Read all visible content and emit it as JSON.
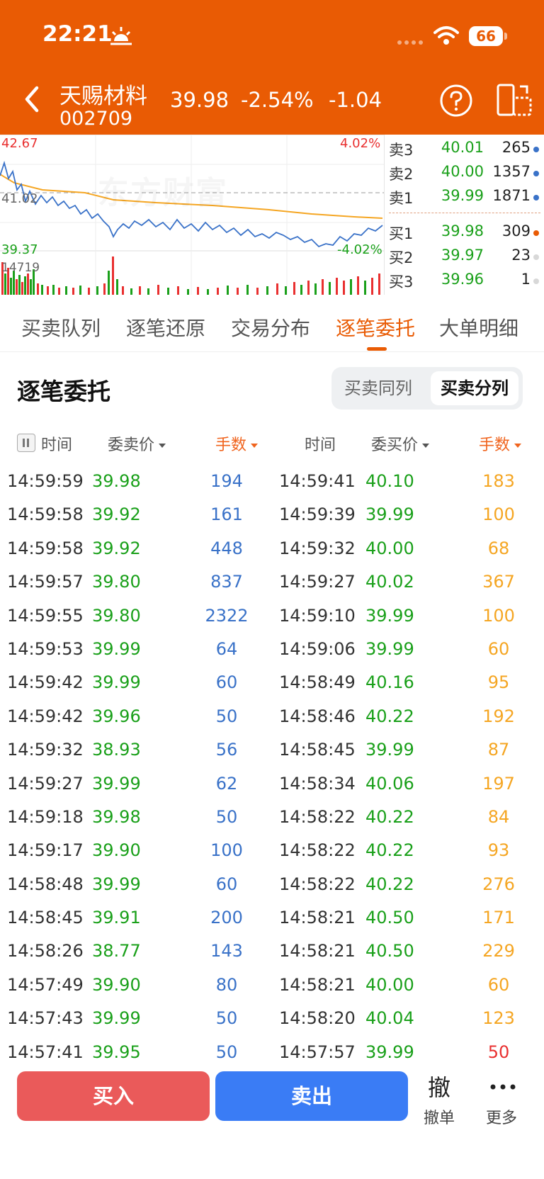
{
  "status_bar": {
    "time": "22:21",
    "battery": "66"
  },
  "header": {
    "stock_name": "天赐材料",
    "stock_code": "002709",
    "price": "39.98",
    "change_pct": "-2.54%",
    "change": "-1.04"
  },
  "chart": {
    "high_label": "42.67",
    "high_pct": "4.02%",
    "prev_close": "41.02",
    "low_label": "39.37",
    "low_pct": "-4.02%",
    "volume_label": "14719",
    "watermark": "东方财富",
    "colors": {
      "price_line": "#3a72c8",
      "avg_line": "#f5a623",
      "up": "#e93030",
      "down": "#1aa01a"
    }
  },
  "order_book": {
    "asks": [
      {
        "label": "卖3",
        "price": "40.01",
        "volume": "265",
        "dot_color": "#3a72c8"
      },
      {
        "label": "卖2",
        "price": "40.00",
        "volume": "1357",
        "dot_color": "#3a72c8"
      },
      {
        "label": "卖1",
        "price": "39.99",
        "volume": "1871",
        "dot_color": "#3a72c8"
      }
    ],
    "bids": [
      {
        "label": "买1",
        "price": "39.98",
        "volume": "309",
        "dot_color": "#e95b04"
      },
      {
        "label": "买2",
        "price": "39.97",
        "volume": "23",
        "dot_color": "#d8d8d8"
      },
      {
        "label": "买3",
        "price": "39.96",
        "volume": "1",
        "dot_color": "#d8d8d8"
      }
    ]
  },
  "tabs": [
    {
      "label": "买卖队列"
    },
    {
      "label": "逐笔还原"
    },
    {
      "label": "交易分布"
    },
    {
      "label": "逐笔委托",
      "active": true
    },
    {
      "label": "大单明细"
    }
  ],
  "section": {
    "title": "逐笔委托",
    "toggle_same": "买卖同列",
    "toggle_split": "买卖分列"
  },
  "columns": {
    "time1": "时间",
    "sell_price": "委卖价",
    "lots1": "手数",
    "time2": "时间",
    "buy_price": "委买价",
    "lots2": "手数"
  },
  "rows": [
    [
      "14:59:59",
      "39.98",
      "194",
      "14:59:41",
      "40.10",
      "183"
    ],
    [
      "14:59:58",
      "39.92",
      "161",
      "14:59:39",
      "39.99",
      "100"
    ],
    [
      "14:59:58",
      "39.92",
      "448",
      "14:59:32",
      "40.00",
      "68"
    ],
    [
      "14:59:57",
      "39.80",
      "837",
      "14:59:27",
      "40.02",
      "367"
    ],
    [
      "14:59:55",
      "39.80",
      "2322",
      "14:59:10",
      "39.99",
      "100"
    ],
    [
      "14:59:53",
      "39.99",
      "64",
      "14:59:06",
      "39.99",
      "60"
    ],
    [
      "14:59:42",
      "39.99",
      "60",
      "14:58:49",
      "40.16",
      "95"
    ],
    [
      "14:59:42",
      "39.96",
      "50",
      "14:58:46",
      "40.22",
      "192"
    ],
    [
      "14:59:32",
      "38.93",
      "56",
      "14:58:45",
      "39.99",
      "87"
    ],
    [
      "14:59:27",
      "39.99",
      "62",
      "14:58:34",
      "40.06",
      "197"
    ],
    [
      "14:59:18",
      "39.98",
      "50",
      "14:58:22",
      "40.22",
      "84"
    ],
    [
      "14:59:17",
      "39.90",
      "100",
      "14:58:22",
      "40.22",
      "93"
    ],
    [
      "14:58:48",
      "39.99",
      "60",
      "14:58:22",
      "40.22",
      "276"
    ],
    [
      "14:58:45",
      "39.91",
      "200",
      "14:58:21",
      "40.50",
      "171"
    ],
    [
      "14:58:26",
      "38.77",
      "143",
      "14:58:21",
      "40.50",
      "229"
    ],
    [
      "14:57:49",
      "39.90",
      "80",
      "14:58:21",
      "40.00",
      "60"
    ],
    [
      "14:57:43",
      "39.99",
      "50",
      "14:58:20",
      "40.04",
      "123"
    ],
    [
      "14:57:41",
      "39.95",
      "50",
      "14:57:57",
      "39.99",
      "50"
    ]
  ],
  "bottom_bar": {
    "buy": "买入",
    "sell": "卖出",
    "cancel_glyph": "撤",
    "cancel_label": "撤单",
    "more_label": "更多"
  }
}
